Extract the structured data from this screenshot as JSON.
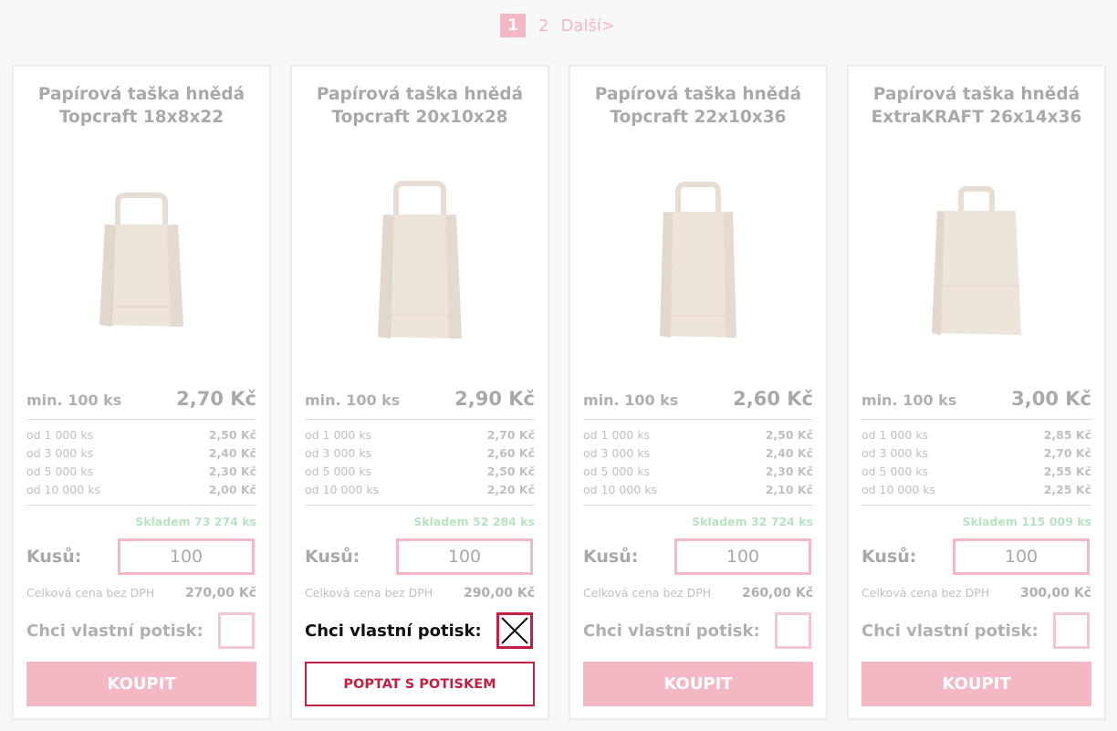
{
  "pagination": {
    "current": "1",
    "page2": "2",
    "next": "Další>"
  },
  "labels": {
    "qty": "Kusů:",
    "total": "Celková cena bez DPH",
    "custom_print": "Chci vlastní potisk:",
    "buy": "KOUPIT",
    "inquire": "POPTAT S POTISKEM"
  },
  "colors": {
    "accent": "#f3b8c3",
    "brand_red": "#c42043",
    "stock_green": "#b7e3c4"
  },
  "products": [
    {
      "title_line1": "Papírová taška hnědá",
      "title_line2": "Topcraft 18x8x22",
      "min_qty": "min. 100 ks",
      "price": "2,70 Kč",
      "tiers": [
        {
          "qty": "od 1 000 ks",
          "price": "2,50 Kč"
        },
        {
          "qty": "od 3 000 ks",
          "price": "2,40 Kč"
        },
        {
          "qty": "od 5 000 ks",
          "price": "2,30 Kč"
        },
        {
          "qty": "od 10 000 ks",
          "price": "2,00 Kč"
        }
      ],
      "stock": "Skladem 73 274 ks",
      "quantity": "100",
      "total": "270,00 Kč",
      "custom_print": false
    },
    {
      "title_line1": "Papírová taška hnědá",
      "title_line2": "Topcraft 20x10x28",
      "min_qty": "min. 100 ks",
      "price": "2,90 Kč",
      "tiers": [
        {
          "qty": "od 1 000 ks",
          "price": "2,70 Kč"
        },
        {
          "qty": "od 3 000 ks",
          "price": "2,60 Kč"
        },
        {
          "qty": "od 5 000 ks",
          "price": "2,50 Kč"
        },
        {
          "qty": "od 10 000 ks",
          "price": "2,20 Kč"
        }
      ],
      "stock": "Skladem 52 284 ks",
      "quantity": "100",
      "total": "290,00 Kč",
      "custom_print": true
    },
    {
      "title_line1": "Papírová taška hnědá",
      "title_line2": "Topcraft 22x10x36",
      "min_qty": "min. 100 ks",
      "price": "2,60 Kč",
      "tiers": [
        {
          "qty": "od 1 000 ks",
          "price": "2,50 Kč"
        },
        {
          "qty": "od 3 000 ks",
          "price": "2,40 Kč"
        },
        {
          "qty": "od 5 000 ks",
          "price": "2,30 Kč"
        },
        {
          "qty": "od 10 000 ks",
          "price": "2,10 Kč"
        }
      ],
      "stock": "Skladem 32 724 ks",
      "quantity": "100",
      "total": "260,00 Kč",
      "custom_print": false
    },
    {
      "title_line1": "Papírová taška hnědá",
      "title_line2": "ExtraKRAFT 26x14x36",
      "min_qty": "min. 100 ks",
      "price": "3,00 Kč",
      "tiers": [
        {
          "qty": "od 1 000 ks",
          "price": "2,85 Kč"
        },
        {
          "qty": "od 3 000 ks",
          "price": "2,70 Kč"
        },
        {
          "qty": "od 5 000 ks",
          "price": "2,55 Kč"
        },
        {
          "qty": "od 10 000 ks",
          "price": "2,25 Kč"
        }
      ],
      "stock": "Skladem 115 009 ks",
      "quantity": "100",
      "total": "300,00 Kč",
      "custom_print": false
    }
  ]
}
